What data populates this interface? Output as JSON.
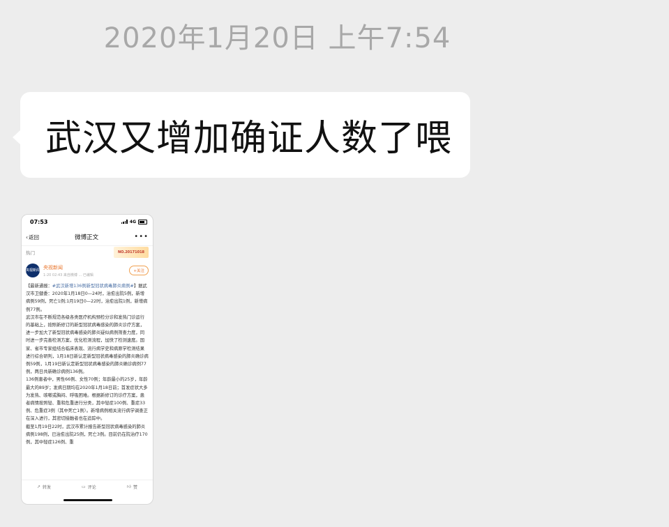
{
  "chat": {
    "timestamp": "2020年1月20日 上午7:54",
    "message": "武汉又增加确证人数了喂"
  },
  "screenshot": {
    "status_time": "07:53",
    "network": "4G",
    "back_label": "返回",
    "page_title": "微博正文",
    "hot_label": "热门",
    "hot_banner": "NO.20171018",
    "author": "央视新闻",
    "avatar_text": "央视新闻",
    "post_meta": "1-20 02:43  来自微博 ...  已编辑",
    "follow_label": "+关注",
    "body_lead": "【最新通报：",
    "body_tag": "#武汉新增136例新型冠状病毒肺炎病例#",
    "body_p1": "】据武汉市卫健委：2020年1月18日0—24时，治愈出院5例，新增病例59例，死亡1例;1月19日0—22时，治愈出院1例，新增病例77例。",
    "body_p2": "武汉市在不断规范各级各类医疗机构预检分诊和发热门诊运行的基础上，按照新修订的新型冠状病毒感染的肺炎诊疗方案，进一步加大了新型冠状病毒感染的肺炎疑似病例筛查力度，同时进一步完善检测方案，优化检测流程，加快了检测速度。国家、省市专家组结合临床表现、流行病学史和病原学检测结果进行综合研判，1月18日新认定新型冠状病毒感染的肺炎确诊病例59例，1月19日新认定新型冠状病毒感染的肺炎确诊病例77例，两日共新确诊病例136例。",
    "body_p3": "136例患者中，男性66例、女性70例；年龄最小的25岁，年龄最大的89岁；发病日期均在2020年1月18日前；首发症状大多为发热、咳嗽或胸闷、呼吸困难。根据新修订的诊疗方案，患者病情按照轻、重和危重进行分类，其中轻症100例、重症33例、危重症3例（其中死亡1例）。新增病例相关流行病学调查正在深入进行，其密切接触者也在追踪中。",
    "body_p4": "截至1月19日22时，武汉市累计报告新型冠状病毒感染的肺炎病例198例，已治愈出院25例，死亡3例。目前仍在院治疗170例，其中轻症126例、重",
    "actions": {
      "repost": "转发",
      "comment": "评论",
      "like": "赞"
    }
  },
  "colors": {
    "background": "#ededed",
    "bubble": "#ffffff",
    "timestamp": "#a8a8a8",
    "accent_orange": "#e8742a",
    "link_blue": "#4a6fa5"
  }
}
